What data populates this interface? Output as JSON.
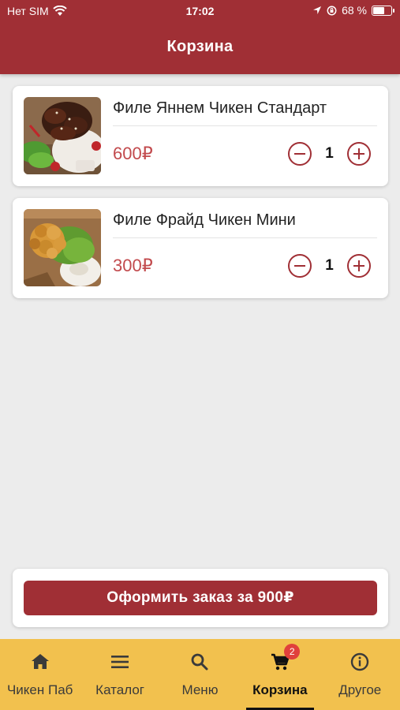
{
  "status_bar": {
    "carrier": "Нет SIM",
    "time": "17:02",
    "battery": "68 %",
    "battery_level": 0.68
  },
  "header": {
    "title": "Корзина"
  },
  "cart": {
    "items": [
      {
        "name": "Филе Яннем Чикен Стандарт",
        "price": "600₽",
        "quantity": "1"
      },
      {
        "name": "Филе Фрайд Чикен Мини",
        "price": "300₽",
        "quantity": "1"
      }
    ]
  },
  "checkout": {
    "button_label": "Оформить заказ за 900₽"
  },
  "tabs": [
    {
      "label": "Чикен Паб",
      "icon": "home-icon"
    },
    {
      "label": "Каталог",
      "icon": "menu-lines-icon"
    },
    {
      "label": "Меню",
      "icon": "search-icon"
    },
    {
      "label": "Корзина",
      "icon": "cart-icon",
      "badge": "2",
      "active": true
    },
    {
      "label": "Другое",
      "icon": "info-icon"
    }
  ],
  "colors": {
    "primary": "#a02f35",
    "price": "#c24a4d",
    "tab_bar": "#f2c14e",
    "badge": "#e0403c",
    "background": "#ececec"
  }
}
